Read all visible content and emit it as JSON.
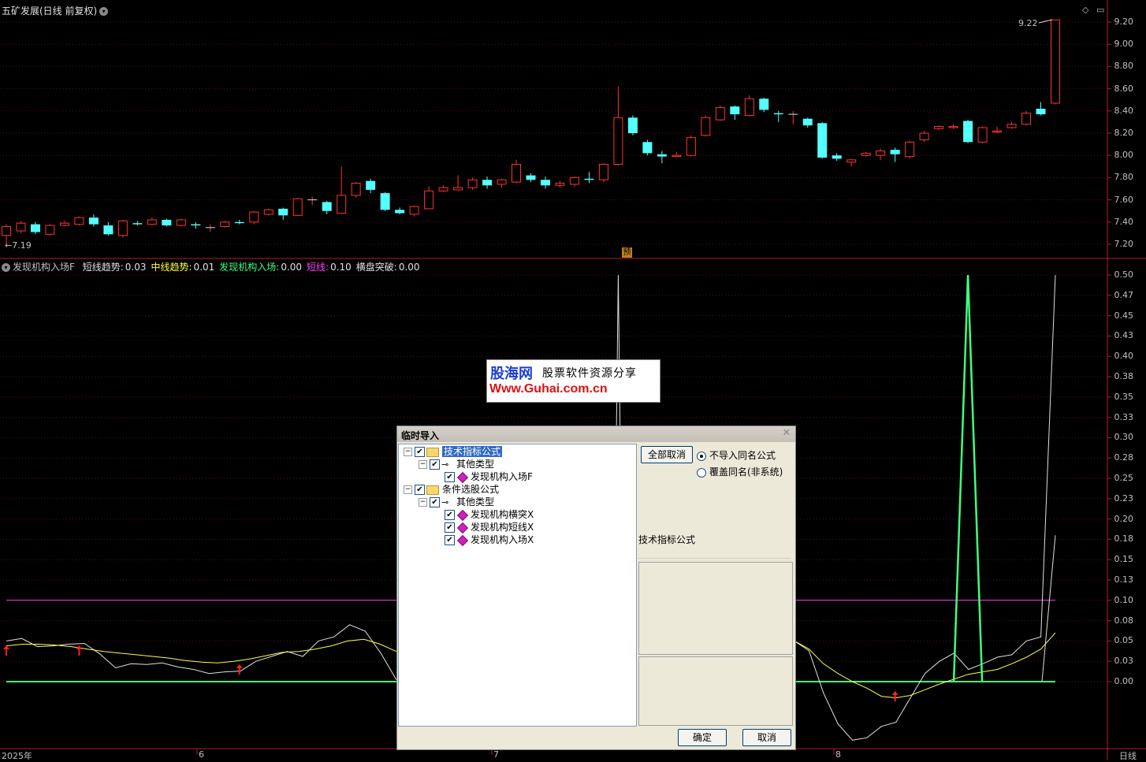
{
  "price_panel": {
    "title": "五矿发展(日线 前复权)",
    "high_label": "9.22",
    "low_label": "←7.19",
    "forecast_badge": "预",
    "y_axis_labels": [
      "9.20",
      "9.00",
      "8.80",
      "8.60",
      "8.40",
      "8.20",
      "8.00",
      "7.80",
      "7.60",
      "7.40",
      "7.20"
    ]
  },
  "indicator_panel": {
    "name": "发现机构入场F",
    "items": [
      {
        "label": "短线趋势:",
        "value": "0.03",
        "color": "#e0e0e0"
      },
      {
        "label": "中线趋势:",
        "value": "0.01",
        "color": "#ffff40"
      },
      {
        "label": "发现机构入场:",
        "value": "0.00",
        "color": "#40ff80"
      },
      {
        "label": "短线:",
        "value": "0.10",
        "color": "#ff40ff"
      },
      {
        "label": "横盘突破:",
        "value": "0.00",
        "color": "#e0e0e0"
      }
    ],
    "y_axis_labels": [
      "0.50",
      "0.47",
      "0.45",
      "0.43",
      "0.40",
      "0.38",
      "0.35",
      "0.33",
      "0.30",
      "0.28",
      "0.25",
      "0.23",
      "0.20",
      "0.18",
      "0.15",
      "0.13",
      "0.10",
      "0.08",
      "0.05",
      "0.03",
      "0.00"
    ]
  },
  "time_axis": {
    "labels": [
      "2025年",
      "6",
      "7",
      "8"
    ],
    "period": "日线"
  },
  "watermark": {
    "brand": "股海网",
    "slogan": "股票软件资源分享",
    "url": "Www.Guhai.com.cn"
  },
  "dialog": {
    "title": "临时导入",
    "tree": [
      {
        "label": "技术指标公式",
        "level": 0,
        "kind": "folder",
        "selected": true
      },
      {
        "label": "其他类型",
        "level": 1,
        "kind": "key"
      },
      {
        "label": "发现机构入场F",
        "level": 2,
        "kind": "item"
      },
      {
        "label": "条件选股公式",
        "level": 0,
        "kind": "folder"
      },
      {
        "label": "其他类型",
        "level": 1,
        "kind": "key"
      },
      {
        "label": "发现机构横突X",
        "level": 2,
        "kind": "item"
      },
      {
        "label": "发现机构短线X",
        "level": 2,
        "kind": "item"
      },
      {
        "label": "发现机构入场X",
        "level": 2,
        "kind": "item"
      }
    ],
    "deselect_all": "全部取消",
    "option_no_import": "不导入同名公式",
    "option_overwrite": "覆盖同名(非系统)",
    "info_label": "技术指标公式",
    "ok": "确定",
    "cancel": "取消"
  },
  "chart_data": {
    "type": "candlestick",
    "title": "五矿发展(日线 前复权)",
    "ylim": [
      7.1,
      9.28
    ],
    "candles": [
      [
        7.28,
        7.36,
        7.38,
        7.19
      ],
      [
        7.32,
        7.39,
        7.41,
        7.3
      ],
      [
        7.38,
        7.31,
        7.4,
        7.29
      ],
      [
        7.29,
        7.37,
        7.38,
        7.28
      ],
      [
        7.37,
        7.39,
        7.41,
        7.36
      ],
      [
        7.38,
        7.44,
        7.45,
        7.37
      ],
      [
        7.44,
        7.38,
        7.47,
        7.36
      ],
      [
        7.37,
        7.29,
        7.4,
        7.28
      ],
      [
        7.28,
        7.41,
        7.42,
        7.26
      ],
      [
        7.39,
        7.38,
        7.41,
        7.37
      ],
      [
        7.38,
        7.42,
        7.44,
        7.37
      ],
      [
        7.42,
        7.37,
        7.43,
        7.36
      ],
      [
        7.37,
        7.42,
        7.43,
        7.36
      ],
      [
        7.38,
        7.37,
        7.4,
        7.34
      ],
      [
        7.35,
        7.35,
        7.38,
        7.31
      ],
      [
        7.36,
        7.4,
        7.41,
        7.35
      ],
      [
        7.4,
        7.39,
        7.42,
        7.38
      ],
      [
        7.4,
        7.49,
        7.5,
        7.38
      ],
      [
        7.47,
        7.51,
        7.52,
        7.46
      ],
      [
        7.52,
        7.46,
        7.53,
        7.42
      ],
      [
        7.46,
        7.61,
        7.62,
        7.46
      ],
      [
        7.6,
        7.6,
        7.63,
        7.55
      ],
      [
        7.58,
        7.5,
        7.59,
        7.47
      ],
      [
        7.48,
        7.64,
        7.9,
        7.48
      ],
      [
        7.64,
        7.75,
        7.76,
        7.62
      ],
      [
        7.77,
        7.69,
        7.79,
        7.66
      ],
      [
        7.66,
        7.51,
        7.67,
        7.5
      ],
      [
        7.51,
        7.48,
        7.53,
        7.47
      ],
      [
        7.47,
        7.54,
        7.55,
        7.45
      ],
      [
        7.52,
        7.68,
        7.72,
        7.52
      ],
      [
        7.68,
        7.71,
        7.73,
        7.67
      ],
      [
        7.69,
        7.71,
        7.82,
        7.68
      ],
      [
        7.71,
        7.78,
        7.8,
        7.69
      ],
      [
        7.78,
        7.73,
        7.81,
        7.7
      ],
      [
        7.74,
        7.78,
        7.79,
        7.71
      ],
      [
        7.76,
        7.92,
        7.96,
        7.75
      ],
      [
        7.82,
        7.78,
        7.84,
        7.76
      ],
      [
        7.78,
        7.73,
        7.81,
        7.7
      ],
      [
        7.73,
        7.75,
        7.77,
        7.71
      ],
      [
        7.74,
        7.8,
        7.81,
        7.72
      ],
      [
        7.79,
        7.78,
        7.85,
        7.75
      ],
      [
        7.78,
        7.92,
        7.93,
        7.76
      ],
      [
        7.92,
        8.34,
        8.62,
        7.91
      ],
      [
        8.34,
        8.2,
        8.36,
        8.18
      ],
      [
        8.12,
        8.02,
        8.14,
        8.0
      ],
      [
        8.01,
        7.99,
        8.04,
        7.93
      ],
      [
        7.99,
        8.0,
        8.03,
        7.99
      ],
      [
        8.0,
        8.16,
        8.18,
        7.99
      ],
      [
        8.18,
        8.34,
        8.36,
        8.17
      ],
      [
        8.32,
        8.43,
        8.45,
        8.31
      ],
      [
        8.44,
        8.37,
        8.45,
        8.32
      ],
      [
        8.36,
        8.51,
        8.54,
        8.35
      ],
      [
        8.51,
        8.41,
        8.52,
        8.39
      ],
      [
        8.38,
        8.37,
        8.4,
        8.3
      ],
      [
        8.37,
        8.37,
        8.4,
        8.28
      ],
      [
        8.33,
        8.27,
        8.34,
        8.25
      ],
      [
        8.29,
        7.98,
        8.3,
        7.97
      ],
      [
        8.0,
        7.97,
        8.02,
        7.95
      ],
      [
        7.94,
        7.96,
        7.97,
        7.9
      ],
      [
        8.0,
        8.02,
        8.03,
        7.99
      ],
      [
        8.0,
        8.04,
        8.06,
        7.96
      ],
      [
        8.05,
        8.01,
        8.07,
        7.94
      ],
      [
        7.99,
        8.12,
        8.13,
        7.97
      ],
      [
        8.14,
        8.2,
        8.22,
        8.12
      ],
      [
        8.24,
        8.26,
        8.27,
        8.23
      ],
      [
        8.25,
        8.26,
        8.28,
        8.24
      ],
      [
        8.31,
        8.12,
        8.32,
        8.11
      ],
      [
        8.12,
        8.25,
        8.26,
        8.11
      ],
      [
        8.21,
        8.22,
        8.26,
        8.2
      ],
      [
        8.25,
        8.28,
        8.3,
        8.24
      ],
      [
        8.28,
        8.38,
        8.4,
        8.27
      ],
      [
        8.42,
        8.37,
        8.48,
        8.36
      ],
      [
        8.47,
        9.22,
        9.22,
        8.46
      ]
    ],
    "indicator": {
      "ylim": [
        0,
        0.5
      ],
      "short_line_value": 0.1,
      "series": [
        {
          "name": "短线趋势",
          "color": "#e0e0e0",
          "values": [
            0.05,
            0.053,
            0.043,
            0.044,
            0.046,
            0.047,
            0.034,
            0.017,
            0.022,
            0.021,
            0.023,
            0.018,
            0.015,
            0.01,
            0.012,
            0.013,
            0.025,
            0.031,
            0.037,
            0.031,
            0.05,
            0.055,
            0.07,
            0.062,
            0.035,
            0.002
          ]
        },
        {
          "name": "中线趋势",
          "color": "#ffff40",
          "values": [
            0.044,
            0.046,
            0.046,
            0.045,
            0.043,
            0.04,
            0.037,
            0.035,
            0.033,
            0.031,
            0.029,
            0.026,
            0.024,
            0.023,
            0.025,
            0.028,
            0.032,
            0.036,
            0.037,
            0.04,
            0.044,
            0.05,
            0.052,
            0.046,
            0.037
          ]
        }
      ],
      "right_series": [
        {
          "name": "短线趋势",
          "color": "#e0e0e0",
          "values": [
            0.05,
            0.038,
            -0.014,
            -0.052,
            -0.072,
            -0.069,
            -0.055,
            -0.05,
            -0.02,
            0.01,
            0.025,
            0.035,
            0.015,
            0.022,
            0.03,
            0.033,
            0.05,
            0.055,
            0.5
          ]
        },
        {
          "name": "中线趋势",
          "color": "#ffff40",
          "values": [
            0.05,
            0.04,
            0.022,
            0.01,
            0.0,
            -0.008,
            -0.018,
            -0.02,
            -0.017,
            -0.01,
            -0.003,
            0.003,
            0.009,
            0.012,
            0.015,
            0.022,
            0.03,
            0.04,
            0.06
          ]
        }
      ],
      "white_spike_at_candle": 42,
      "green_spike_at_candle": 66,
      "signal_arrows_at_candles": [
        0,
        5,
        16,
        61
      ]
    }
  }
}
